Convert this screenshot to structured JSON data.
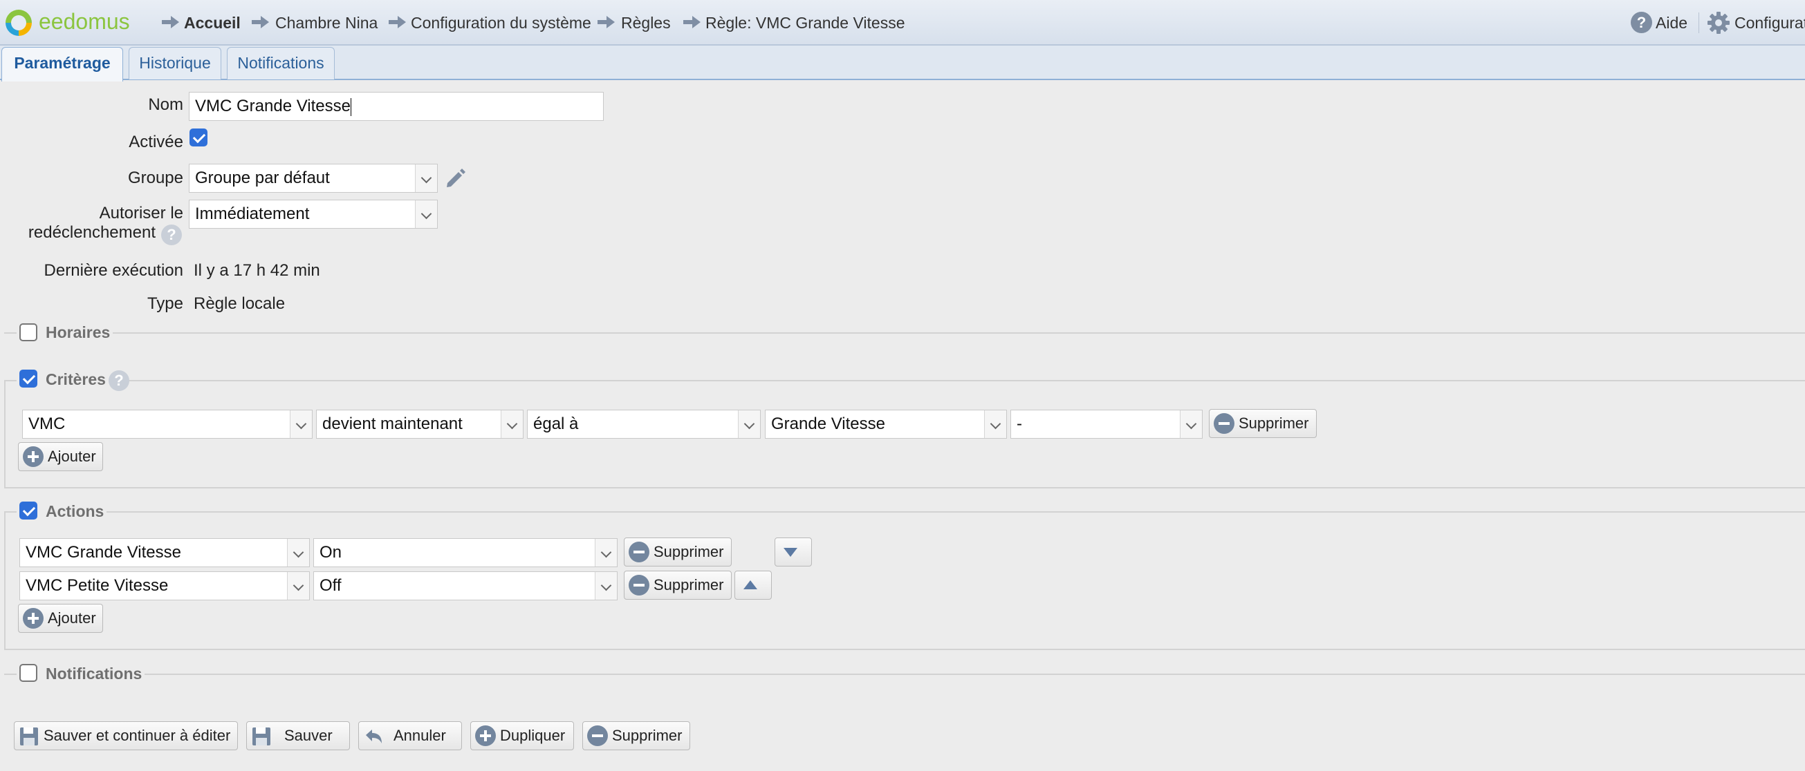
{
  "header": {
    "logo_text": "eedomus",
    "breadcrumbs": [
      "Accueil",
      "Chambre Nina",
      "Configuration du système",
      "Règles",
      "Règle: VMC Grande Vitesse"
    ],
    "help_label": "Aide",
    "config_label": "Configurati"
  },
  "tabs": [
    "Paramétrage",
    "Historique",
    "Notifications"
  ],
  "active_tab": "Paramétrage",
  "form": {
    "nom_label": "Nom",
    "nom_value": "VMC Grande Vitesse",
    "activee_label": "Activée",
    "activee_checked": true,
    "groupe_label": "Groupe",
    "groupe_value": "Groupe par défaut",
    "autoriser_label_1": "Autoriser le",
    "autoriser_label_2": "redéclenchement",
    "autoriser_value": "Immédiatement",
    "derniere_label": "Dernière exécution",
    "derniere_value": "Il y a 17 h 42 min",
    "type_label": "Type",
    "type_value": "Règle locale"
  },
  "sections": {
    "horaires": {
      "label": "Horaires",
      "checked": false
    },
    "criteres": {
      "label": "Critères",
      "checked": true
    },
    "actions": {
      "label": "Actions",
      "checked": true
    },
    "notifications": {
      "label": "Notifications",
      "checked": false
    }
  },
  "criteria": [
    {
      "device": "VMC",
      "condition": "devient maintenant",
      "operator": "égal à",
      "value": "Grande Vitesse",
      "extra": "-",
      "delete_label": "Supprimer"
    }
  ],
  "criteria_add_label": "Ajouter",
  "actions": [
    {
      "device": "VMC Grande Vitesse",
      "value": "On",
      "delete_label": "Supprimer"
    },
    {
      "device": "VMC Petite Vitesse",
      "value": "Off",
      "delete_label": "Supprimer"
    }
  ],
  "actions_add_label": "Ajouter",
  "footer_buttons": {
    "save_continue": "Sauver et continuer à éditer",
    "save": "Sauver",
    "cancel": "Annuler",
    "duplicate": "Dupliquer",
    "delete": "Supprimer"
  },
  "colors": {
    "accent": "#2e6fd9",
    "tab_text": "#2b5f99",
    "logo": "#8bc53f"
  }
}
